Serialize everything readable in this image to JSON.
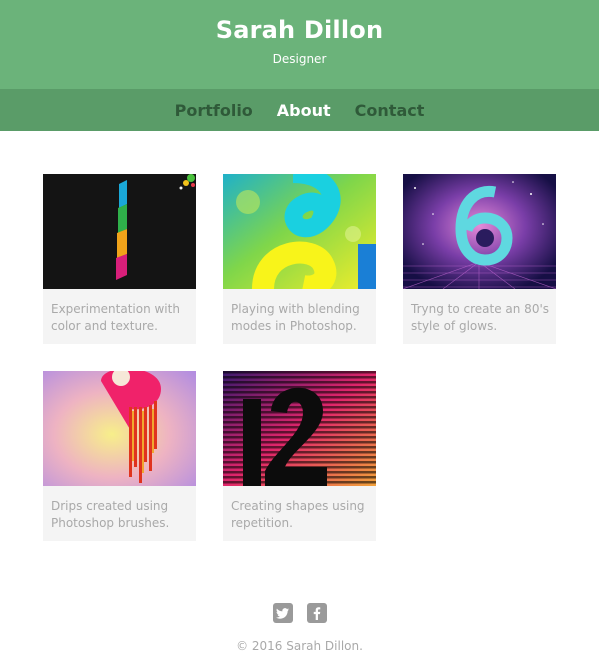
{
  "header": {
    "title": "Sarah Dillon",
    "subtitle": "Designer"
  },
  "nav": {
    "items": [
      {
        "label": "Portfolio",
        "active": false
      },
      {
        "label": "About",
        "active": true
      },
      {
        "label": "Contact",
        "active": false
      }
    ]
  },
  "portfolio": {
    "items": [
      {
        "caption": "Experimentation with color and texture.",
        "image": "colorful-stripe-artwork"
      },
      {
        "caption": "Playing with blending modes in Photoshop.",
        "image": "blended-number-artwork"
      },
      {
        "caption": "Tryng to create an 80's style of glows.",
        "image": "glowing-six-artwork"
      },
      {
        "caption": "Drips created using Photoshop brushes.",
        "image": "dripping-nine-artwork"
      },
      {
        "caption": "Creating shapes using repetition.",
        "image": "striped-twelve-artwork"
      }
    ]
  },
  "footer": {
    "social": [
      {
        "icon": "twitter-icon"
      },
      {
        "icon": "facebook-icon"
      }
    ],
    "copyright": "© 2016 Sarah Dillon."
  },
  "colors": {
    "header": "#6bb37a",
    "nav": "#5a9c68",
    "nav_text": "#2f5a39",
    "caption": "#a9a9a9",
    "card": "#f4f4f4"
  }
}
